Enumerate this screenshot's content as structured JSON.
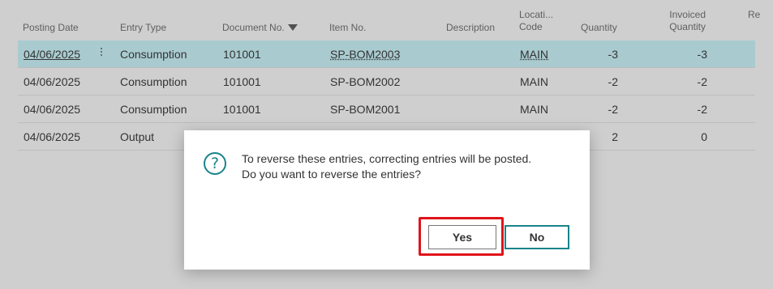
{
  "columns": {
    "posting_date": "Posting Date",
    "entry_type": "Entry Type",
    "document_no": "Document No.",
    "item_no": "Item No.",
    "description": "Description",
    "location_line1": "Locati...",
    "location_line2": "Code",
    "quantity": "Quantity",
    "invoiced_line1": "Invoiced",
    "invoiced_line2": "Quantity",
    "extra": "Re"
  },
  "rows": [
    {
      "date": "04/06/2025",
      "entry_type": "Consumption",
      "doc": "101001",
      "item": "SP-BOM2003",
      "location": "MAIN",
      "qty": "-3",
      "inv_qty": "-3",
      "selected": true
    },
    {
      "date": "04/06/2025",
      "entry_type": "Consumption",
      "doc": "101001",
      "item": "SP-BOM2002",
      "location": "MAIN",
      "qty": "-2",
      "inv_qty": "-2",
      "selected": false
    },
    {
      "date": "04/06/2025",
      "entry_type": "Consumption",
      "doc": "101001",
      "item": "SP-BOM2001",
      "location": "MAIN",
      "qty": "-2",
      "inv_qty": "-2",
      "selected": false
    },
    {
      "date": "04/06/2025",
      "entry_type": "Output",
      "doc": "",
      "item": "",
      "location": "",
      "qty": "2",
      "inv_qty": "0",
      "selected": false
    }
  ],
  "dialog": {
    "icon": "question-icon",
    "line1": "To reverse these entries, correcting entries will be posted.",
    "line2": "Do you want to reverse the entries?",
    "yes_label": "Yes",
    "no_label": "No",
    "highlight_color": "#e0141b",
    "accent_color": "#19848a"
  }
}
